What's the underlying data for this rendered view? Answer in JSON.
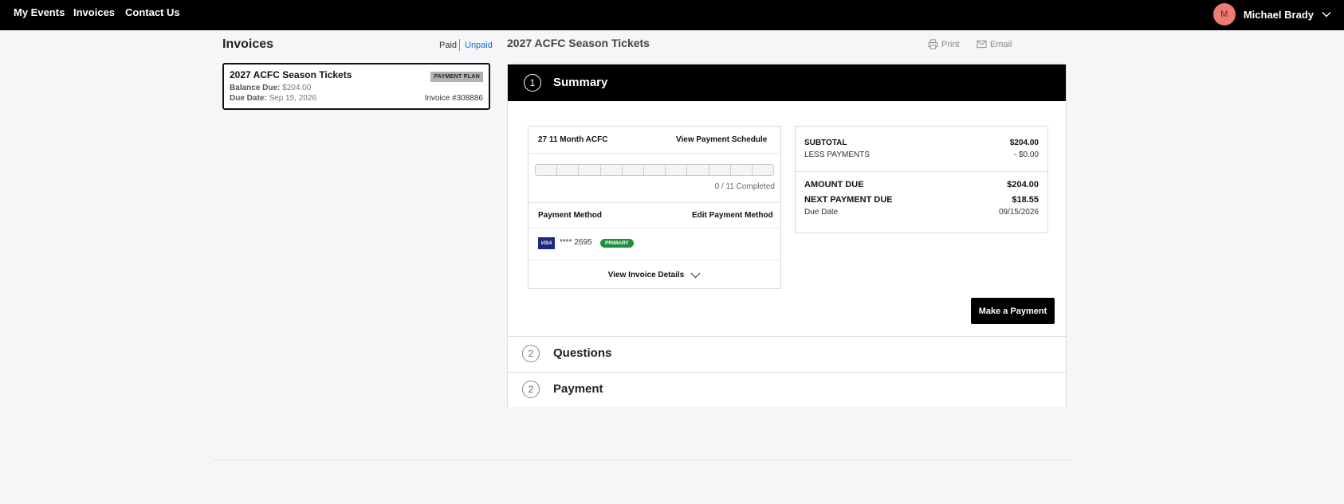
{
  "nav": {
    "items": [
      {
        "label": "My Events"
      },
      {
        "label": "Invoices"
      },
      {
        "label": "Contact Us"
      }
    ],
    "user": {
      "initial": "M",
      "name": "Michael Brady"
    }
  },
  "sidebar": {
    "title": "Invoices",
    "filters": {
      "paid": "Paid",
      "unpaid": "Unpaid"
    },
    "invoice": {
      "title": "2027 ACFC Season Tickets",
      "badge": "PAYMENT PLAN",
      "balance_label": "Balance Due:",
      "balance_value": "$204.00",
      "due_label": "Due Date:",
      "due_value": "Sep 15, 2026",
      "number": "Invoice #308886"
    }
  },
  "main": {
    "title": "2027 ACFC Season Tickets",
    "print_label": "Print",
    "email_label": "Email",
    "summary": {
      "step": "1",
      "label": "Summary",
      "plan_name": "27 11 Month ACFC",
      "view_schedule": "View Payment Schedule",
      "progress": {
        "completed": 0,
        "total": 11,
        "text": "0 / 11 Completed"
      },
      "payment_method_label": "Payment Method",
      "edit_payment_method": "Edit Payment Method",
      "card_brand": "VISA",
      "card_masked": "**** 2695",
      "card_badge": "PRIMARY",
      "view_invoice_details": "View Invoice Details",
      "subtotal_label": "SUBTOTAL",
      "subtotal_value": "$204.00",
      "less_payments_label": "LESS PAYMENTS",
      "less_payments_value": "- $0.00",
      "amount_due_label": "AMOUNT DUE",
      "amount_due_value": "$204.00",
      "next_payment_label": "NEXT PAYMENT DUE",
      "next_payment_value": "$18.55",
      "due_date_label": "Due Date",
      "due_date_value": "09/15/2026",
      "pay_button": "Make a Payment"
    },
    "sections": [
      {
        "step": "2",
        "label": "Questions"
      },
      {
        "step": "2",
        "label": "Payment"
      }
    ]
  },
  "colors": {
    "topbar": "#000000",
    "avatar": "#f07b72",
    "link": "#1a66c8",
    "primary_badge": "#1e8e3e",
    "visa": "#1b2a7a"
  }
}
